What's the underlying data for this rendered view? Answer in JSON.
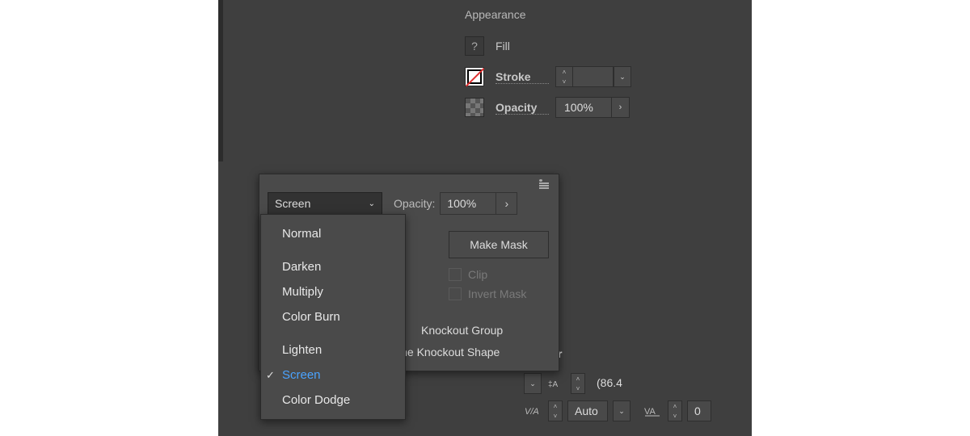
{
  "appearance": {
    "title": "Appearance",
    "fill_label": "Fill",
    "fill_swatch": "?",
    "stroke_label": "Stroke",
    "opacity_label": "Opacity",
    "opacity_value": "100%"
  },
  "transparency": {
    "blend_selected": "Screen",
    "opacity_label": "Opacity:",
    "opacity_value": "100%",
    "make_mask": "Make Mask",
    "clip": "Clip",
    "invert_mask": "Invert Mask",
    "knockout_group": "Knockout Group",
    "knockout_shape_partial": "ine Knockout Shape",
    "blend_modes": [
      "Normal",
      "Darken",
      "Multiply",
      "Color Burn",
      "Lighten",
      "Screen",
      "Color Dodge"
    ],
    "selected_mode": "Screen"
  },
  "character": {
    "label_partial": "mputer",
    "leading_value_partial": "(86.4",
    "kerning_value": "Auto",
    "tracking_value": "0"
  }
}
